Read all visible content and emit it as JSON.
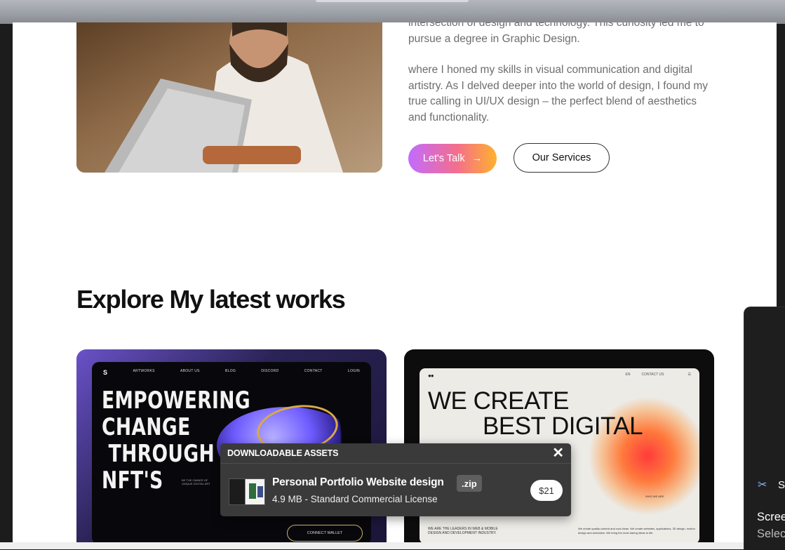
{
  "about": {
    "para1": "intersection of design and technology. This curiosity led me to pursue a degree in Graphic Design.",
    "para2": "where I honed my skills in visual communication and digital artistry. As I delved deeper into the world of design, I found my true calling in UI/UX design – the perfect blend of aesthetics and functionality."
  },
  "buttons": {
    "talk": "Let's Talk",
    "talk_arrow": "→",
    "services": "Our Services"
  },
  "works": {
    "title": "Explore My latest works",
    "card1": {
      "logo": "S",
      "nav": [
        "ARTWORKS",
        "ABOUT US",
        "BLOG",
        "DISCORD",
        "CONTACT",
        "LOGIN"
      ],
      "headline": "EMPOWERING\nCHANGE\n THROUGH\nNFT'S",
      "caption": "BE THE OWNER OF UNIQUE DIGITAL ART",
      "wallet": "CONNECT WALLET"
    },
    "card2": {
      "nav_dots": "●●",
      "nav_en": "EN",
      "nav_contact": "CONTACT US",
      "headline_line1": "WE CREATE",
      "headline_line2": "BEST DIGITAL",
      "who": "WHO WE ARE",
      "footer_left": "WE ARE THE LEADERS IN WEB & MOBILE DESIGN AND DEVELOPMENT INDUSTRY.",
      "footer_right": "We create quality content and cool ideas. We create websites, applications, 3D design, motion design and animation. We bring the most daring ideas to life."
    }
  },
  "modal": {
    "title": "DOWNLOADABLE ASSETS",
    "close": "✕",
    "asset_name": "Personal Portfolio Website design",
    "asset_badge": ".zip",
    "asset_meta": "4.9 MB - Standard Commercial License",
    "price": "$21"
  },
  "side_panel": {
    "icon": "snipping-tool-icon",
    "label_fragment": "S",
    "title": "Scree",
    "subtitle": "Selec"
  }
}
